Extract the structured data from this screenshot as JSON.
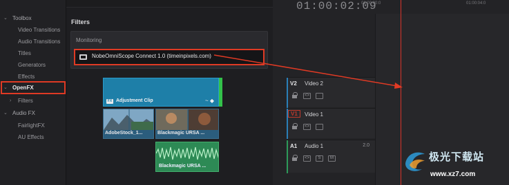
{
  "sidebar": {
    "items": [
      {
        "label": "Toolbox",
        "kind": "cat",
        "expanded": true
      },
      {
        "label": "Video Transitions",
        "kind": "sub"
      },
      {
        "label": "Audio Transitions",
        "kind": "sub"
      },
      {
        "label": "Titles",
        "kind": "sub"
      },
      {
        "label": "Generators",
        "kind": "sub"
      },
      {
        "label": "Effects",
        "kind": "sub"
      },
      {
        "label": "OpenFX",
        "kind": "cat",
        "expanded": true,
        "highlighted": true
      },
      {
        "label": "Filters",
        "kind": "sub",
        "expandable": true
      },
      {
        "label": "Audio FX",
        "kind": "cat",
        "expanded": true
      },
      {
        "label": "FairlightFX",
        "kind": "sub"
      },
      {
        "label": "AU Effects",
        "kind": "sub"
      }
    ]
  },
  "filters_panel": {
    "title": "Filters",
    "group_header": "Monitoring",
    "plugin_label": "NobeOmniScope Connect 1.0 (timeinpixels.com)",
    "highlight_color": "#e03a24"
  },
  "timeline": {
    "timecode": "01:00:02:09",
    "ruler_labels": [
      "01:00:00:0",
      "01:00:04:0"
    ],
    "tracks": [
      {
        "id": "V2",
        "name": "Video 2",
        "extra": "",
        "stripe_color": "#2a7fb8"
      },
      {
        "id": "V1",
        "name": "Video 1",
        "extra": "",
        "stripe_color": "#2a7fb8"
      },
      {
        "id": "A1",
        "name": "Audio 1",
        "extra": "2.0",
        "stripe_color": "#2d9a5a"
      }
    ],
    "audio_buttons": [
      "S",
      "M"
    ],
    "clips": {
      "adjustment": "Adjustment Clip",
      "fx_badge": "FX",
      "video1": "AdobeStock_1...",
      "video2": "Blackmagic URSA ...",
      "audio": "Blackmagic URSA ..."
    },
    "playhead_color": "#d9342b"
  },
  "watermark": {
    "text1": "极光下载站",
    "text2": "www.xz7.com"
  }
}
